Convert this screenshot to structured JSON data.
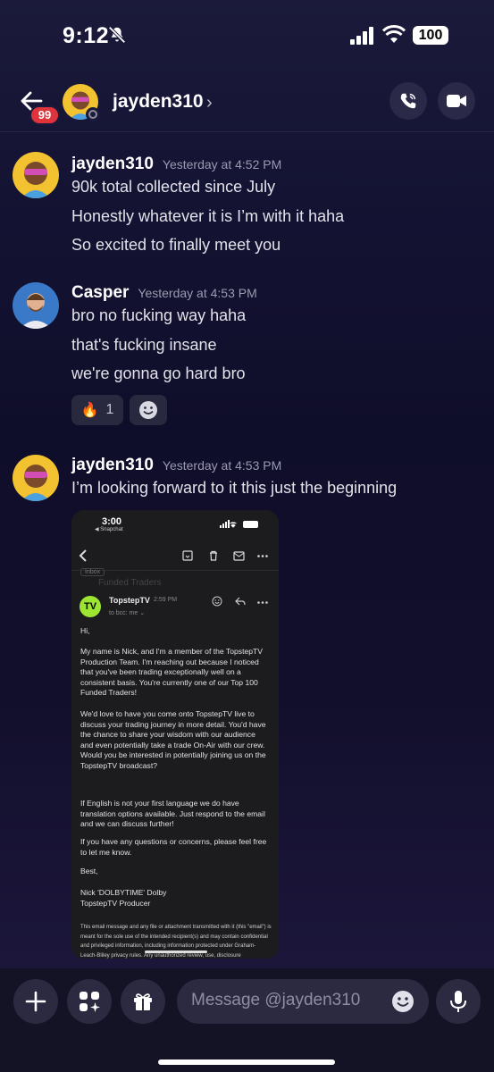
{
  "status_bar": {
    "time": "9:12",
    "battery": "100"
  },
  "header": {
    "unread_badge": "99",
    "username": "jayden310",
    "chevron": "›"
  },
  "messages": [
    {
      "author": "jayden310",
      "timestamp": "Yesterday at 4:52 PM",
      "lines": [
        "90k total collected since July",
        "Honestly whatever it is I’m with it haha",
        "So excited to finally meet you"
      ]
    },
    {
      "author": "Casper",
      "timestamp": "Yesterday at 4:53 PM",
      "lines": [
        "bro no fucking way haha",
        "that's fucking insane",
        "we're gonna go hard bro"
      ],
      "reaction": {
        "emoji": "🔥",
        "count": "1"
      }
    },
    {
      "author": "jayden310",
      "timestamp": "Yesterday at 4:53 PM",
      "lines": [
        "I’m looking forward to it this just the beginning"
      ]
    }
  ],
  "attachment": {
    "status_time": "3:00",
    "status_app": "◀ Snapchat",
    "faded_subject": "Funded Traders",
    "inbox_tag": "Inbox",
    "logo_text": "TV",
    "sender": "TopstepTV",
    "send_time": "2:59 PM",
    "recipient": "to bcc: me ⌄",
    "paragraphs": [
      "Hi,",
      "My name is Nick, and I'm a member of the TopstepTV Production Team. I'm reaching out because I noticed that you've been trading exceptionally well on a consistent basis. You're currently one of our Top 100 Funded Traders!",
      "We'd love to have you come onto TopstepTV live to discuss your trading journey in more detail. You'd have the chance to share your wisdom with our audience and even potentially take a trade On-Air with our crew. Would you be interested in potentially joining us on the TopstepTV broadcast?",
      "If English is not your first language we do have translation options available. Just respond to the email and we can discuss further!",
      "If you have any questions or concerns, please feel free to let me know.",
      "Best,",
      "Nick 'DOLBYTIME' Dolby",
      "TopstepTV Producer"
    ],
    "legal": "This email message and any file or attachment transmitted with it (this \"email\") is meant for the sole use of the intended recipient(s) and may contain confidential and privileged information, including information protected under Graham-Leach-Bliley privacy rules. Any unauthorized review, use, disclosure"
  },
  "composer": {
    "placeholder": "Message @jayden310"
  },
  "icons": [
    "bell-slash-icon",
    "signal-icon",
    "wifi-icon",
    "back-arrow-icon",
    "phone-icon",
    "video-camera-icon",
    "smiley-add-icon",
    "plus-icon",
    "apps-icon",
    "gift-icon",
    "emoji-icon",
    "microphone-icon"
  ],
  "colors": {
    "badge": "#e0343c",
    "logo": "#9ce633",
    "background": "#141333"
  }
}
